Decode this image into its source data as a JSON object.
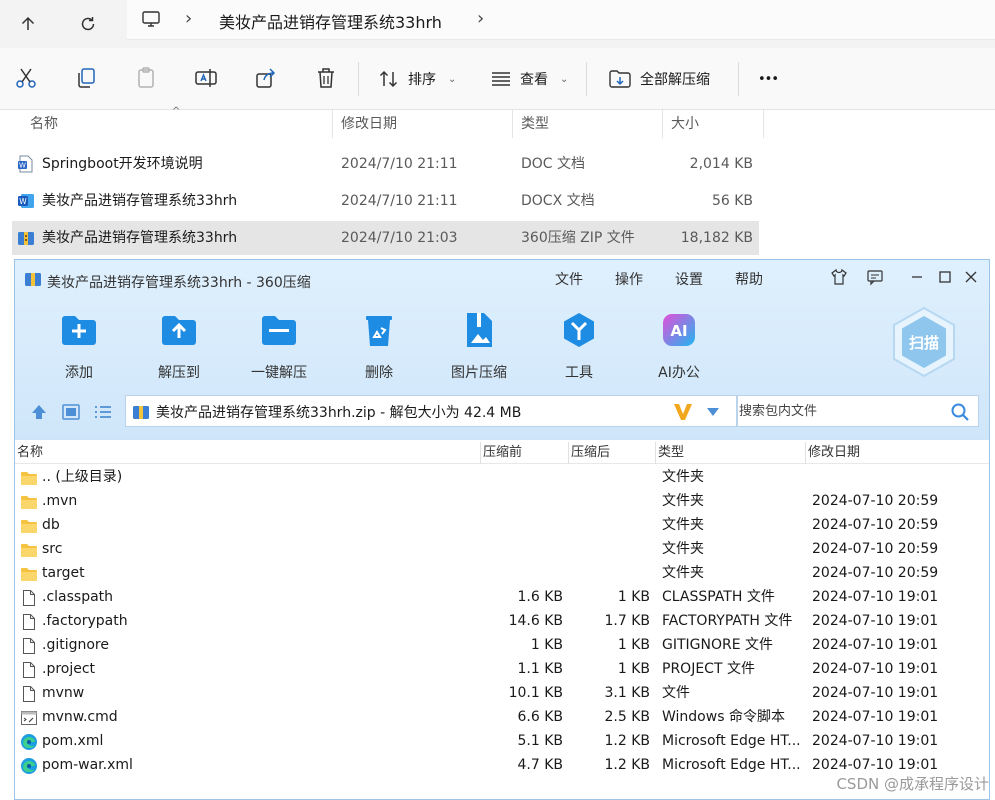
{
  "explorer": {
    "breadcrumb": "美妆产品进销存管理系统33hrh",
    "toolbar": {
      "sort_label": "排序",
      "view_label": "查看",
      "extract_all_label": "全部解压缩",
      "more_label": "•••"
    },
    "columns": {
      "name": "名称",
      "date": "修改日期",
      "type": "类型",
      "size": "大小"
    },
    "files": [
      {
        "name": "Springboot开发环境说明",
        "date": "2024/7/10 21:11",
        "type": "DOC 文档",
        "size": "2,014 KB",
        "icon": "word-doc-icon"
      },
      {
        "name": "美妆产品进销存管理系统33hrh",
        "date": "2024/7/10 21:11",
        "type": "DOCX 文档",
        "size": "56 KB",
        "icon": "word-docx-icon"
      },
      {
        "name": "美妆产品进销存管理系统33hrh",
        "date": "2024/7/10 21:03",
        "type": "360压缩 ZIP 文件",
        "size": "18,182 KB",
        "icon": "zip-archive-icon"
      }
    ]
  },
  "zip": {
    "title": "美妆产品进销存管理系统33hrh - 360压缩",
    "menu": [
      "文件",
      "操作",
      "设置",
      "帮助"
    ],
    "tools": [
      "添加",
      "解压到",
      "一键解压",
      "删除",
      "图片压缩",
      "工具",
      "AI办公"
    ],
    "ai_icon_text": "AI",
    "scan_label": "扫描",
    "path": "美妆产品进销存管理系统33hrh.zip - 解包大小为 42.4 MB",
    "search_placeholder": "搜索包内文件",
    "columns": {
      "name": "名称",
      "before": "压缩前",
      "after": "压缩后",
      "type": "类型",
      "date": "修改日期"
    },
    "rows": [
      {
        "name": ".. (上级目录)",
        "before": "",
        "after": "",
        "type": "文件夹",
        "date": "",
        "icon": "folder"
      },
      {
        "name": ".mvn",
        "before": "",
        "after": "",
        "type": "文件夹",
        "date": "2024-07-10 20:59",
        "icon": "folder"
      },
      {
        "name": "db",
        "before": "",
        "after": "",
        "type": "文件夹",
        "date": "2024-07-10 20:59",
        "icon": "folder"
      },
      {
        "name": "src",
        "before": "",
        "after": "",
        "type": "文件夹",
        "date": "2024-07-10 20:59",
        "icon": "folder"
      },
      {
        "name": "target",
        "before": "",
        "after": "",
        "type": "文件夹",
        "date": "2024-07-10 20:59",
        "icon": "folder"
      },
      {
        "name": ".classpath",
        "before": "1.6 KB",
        "after": "1 KB",
        "type": "CLASSPATH 文件",
        "date": "2024-07-10 19:01",
        "icon": "file"
      },
      {
        "name": ".factorypath",
        "before": "14.6 KB",
        "after": "1.7 KB",
        "type": "FACTORYPATH 文件",
        "date": "2024-07-10 19:01",
        "icon": "file"
      },
      {
        "name": ".gitignore",
        "before": "1 KB",
        "after": "1 KB",
        "type": "GITIGNORE 文件",
        "date": "2024-07-10 19:01",
        "icon": "file"
      },
      {
        "name": ".project",
        "before": "1.1 KB",
        "after": "1 KB",
        "type": "PROJECT 文件",
        "date": "2024-07-10 19:01",
        "icon": "file"
      },
      {
        "name": "mvnw",
        "before": "10.1 KB",
        "after": "3.1 KB",
        "type": "文件",
        "date": "2024-07-10 19:01",
        "icon": "file"
      },
      {
        "name": "mvnw.cmd",
        "before": "6.6 KB",
        "after": "2.5 KB",
        "type": "Windows 命令脚本",
        "date": "2024-07-10 19:01",
        "icon": "cmd"
      },
      {
        "name": "pom.xml",
        "before": "5.1 KB",
        "after": "1.2 KB",
        "type": "Microsoft Edge HT...",
        "date": "2024-07-10 19:01",
        "icon": "edge"
      },
      {
        "name": "pom-war.xml",
        "before": "4.7 KB",
        "after": "1.2 KB",
        "type": "Microsoft Edge HT...",
        "date": "2024-07-10 19:01",
        "icon": "edge"
      }
    ]
  },
  "watermark": "CSDN @成承程序设计",
  "colors": {
    "accent_blue": "#1e8ce3",
    "folder_yellow": "#f5c242",
    "selected_row": "#e5e5e5",
    "zip_header": "#dff0fd"
  }
}
